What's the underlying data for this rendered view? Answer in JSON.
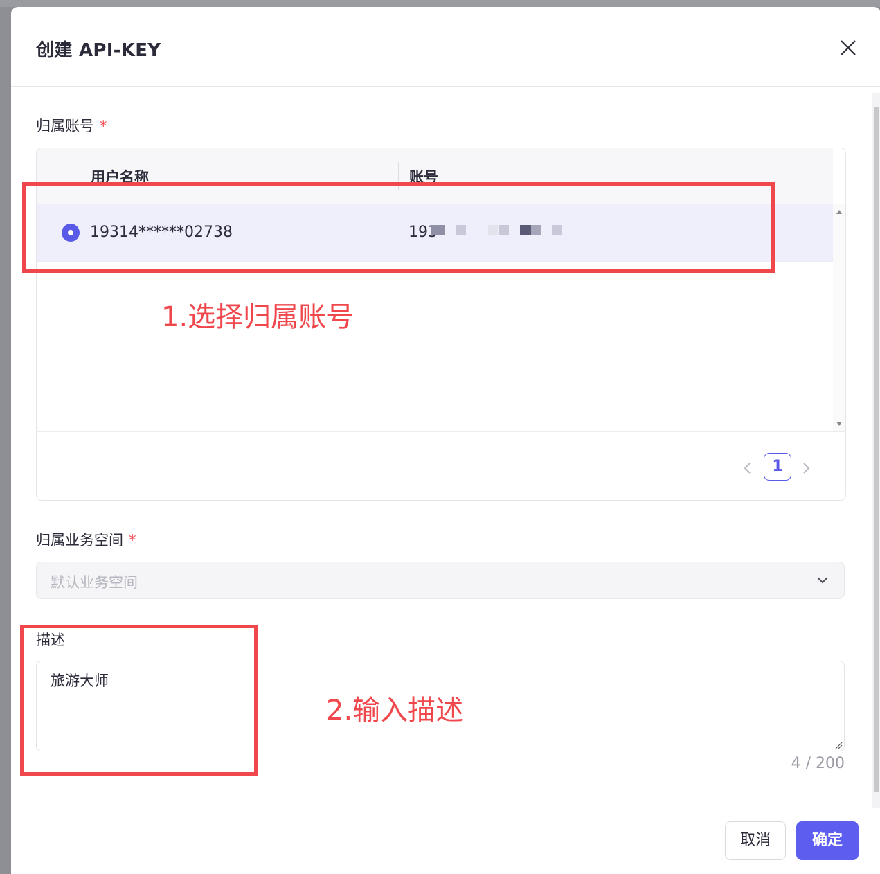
{
  "dialog": {
    "title": "创建 API-KEY",
    "close_icon": "close-icon"
  },
  "account_field": {
    "label": "归属账号",
    "required_mark": "*",
    "columns": [
      "用户名称",
      "账号"
    ],
    "rows": [
      {
        "selected": true,
        "username": "19314******02738",
        "account_prefix": "193"
      }
    ],
    "pagination": {
      "current_page": "1",
      "prev_icon": "chevron-left-icon",
      "next_icon": "chevron-right-icon"
    }
  },
  "workspace_field": {
    "label": "归属业务空间",
    "required_mark": "*",
    "placeholder": "默认业务空间",
    "dropdown_icon": "chevron-down-icon"
  },
  "description_field": {
    "label": "描述",
    "value": "旅游大师",
    "char_count": "4 / 200"
  },
  "footer": {
    "cancel_label": "取消",
    "confirm_label": "确定"
  },
  "annotations": {
    "step1": "1.选择归属账号",
    "step2": "2.输入描述",
    "color": "#f0474d"
  },
  "colors": {
    "accent": "#5d5df0",
    "required": "#f2464f",
    "selected_row_bg": "#efeffb"
  }
}
